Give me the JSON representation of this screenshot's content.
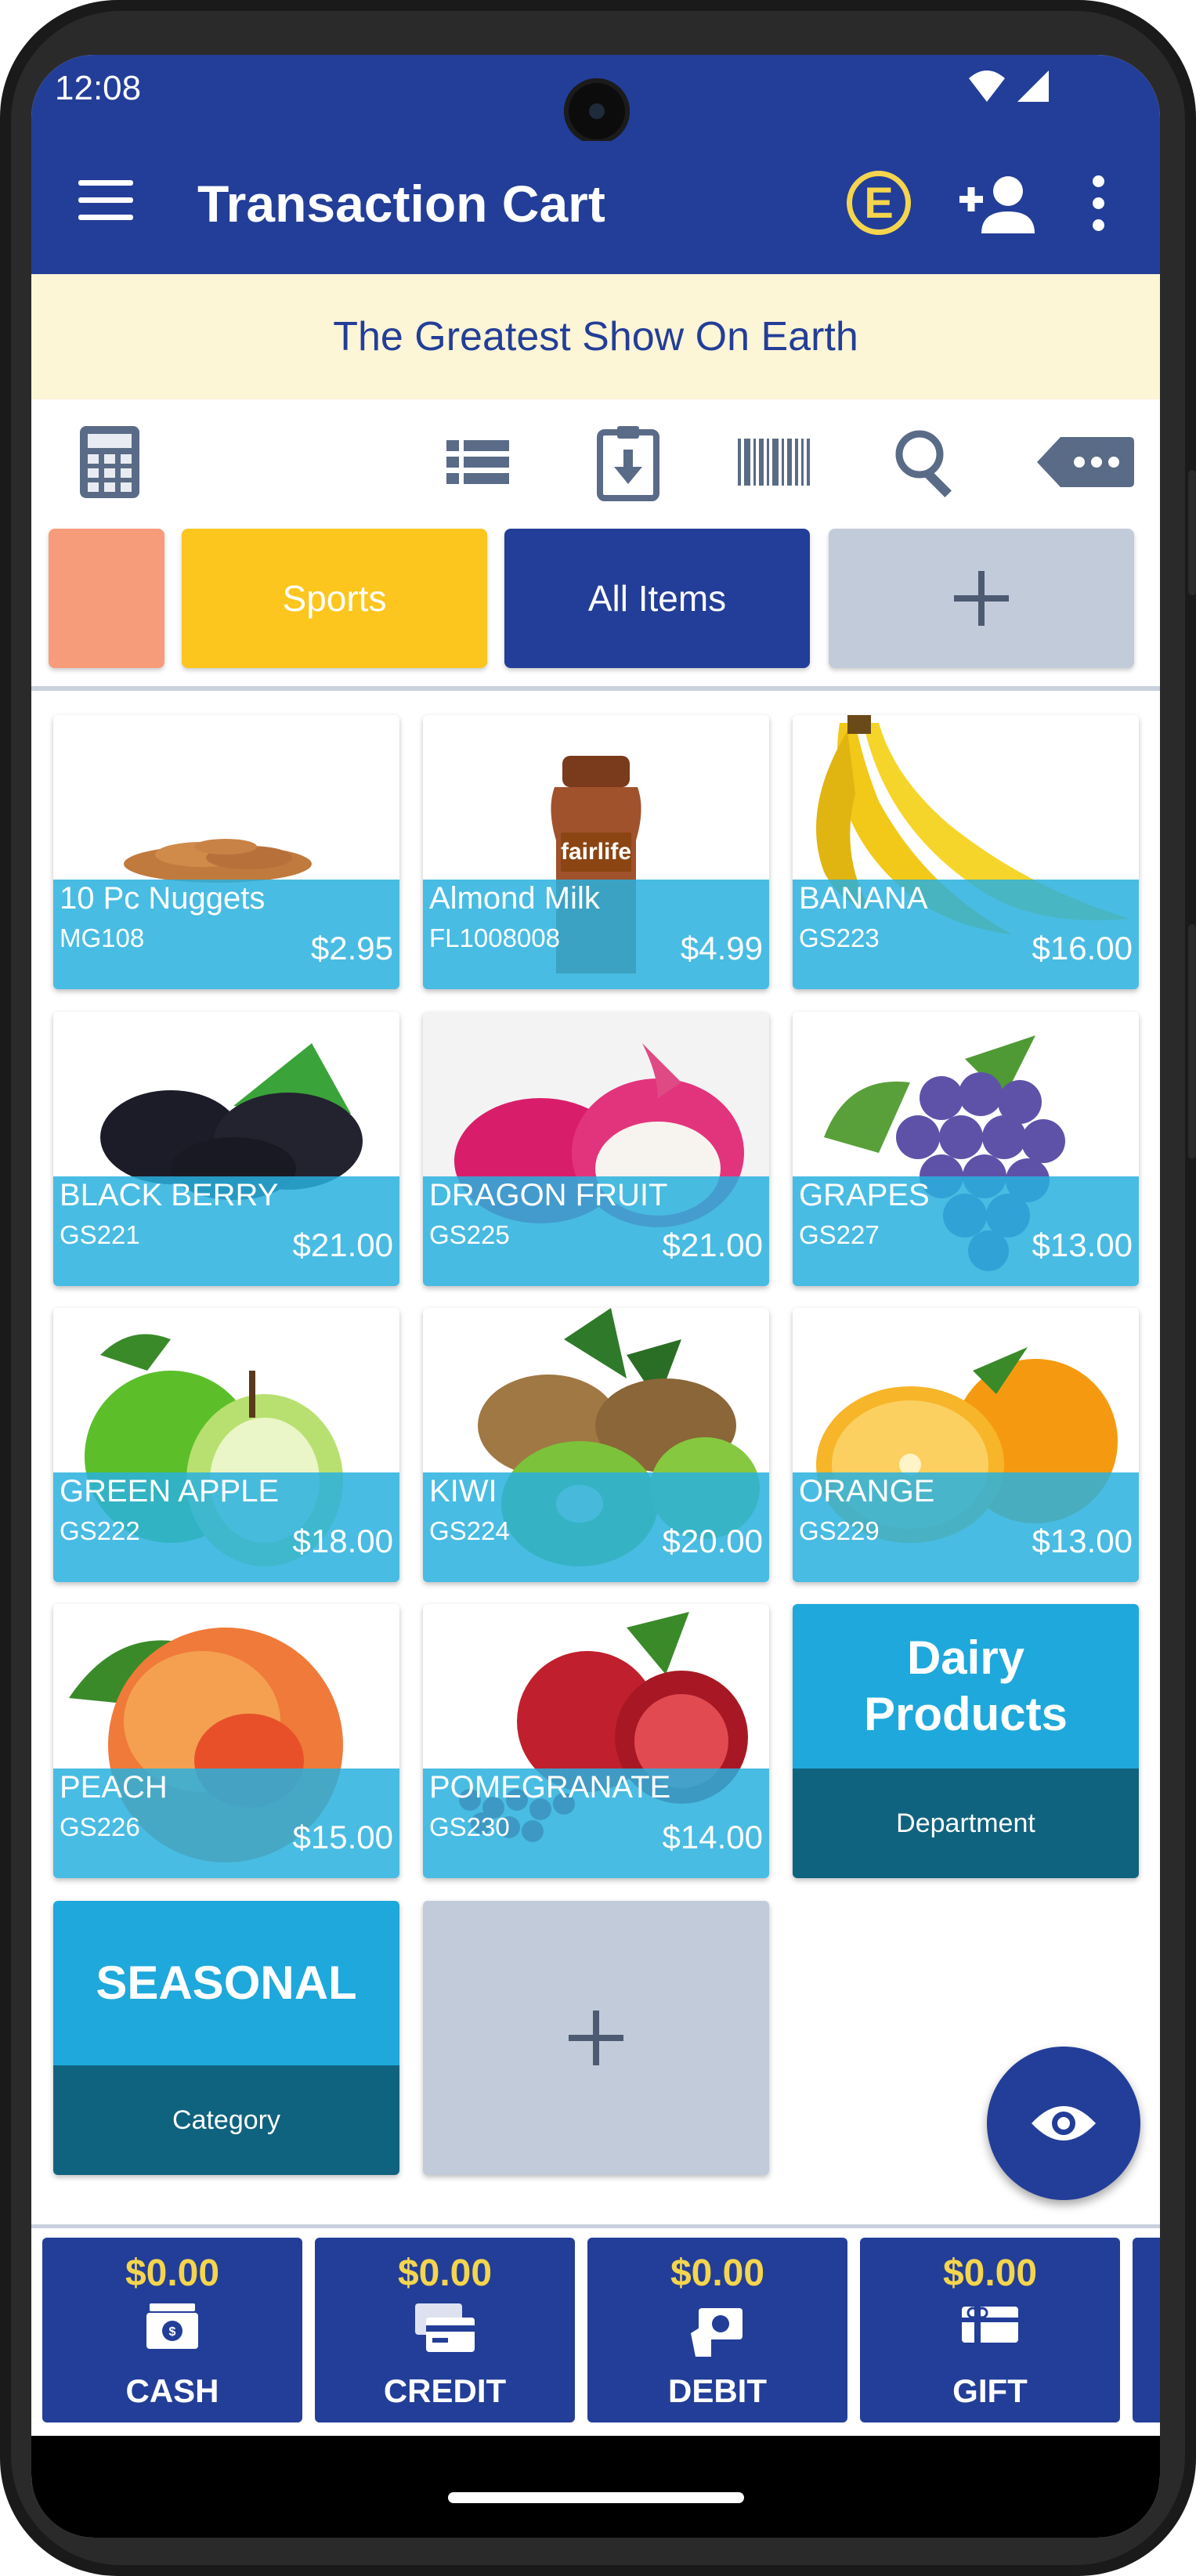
{
  "status_bar": {
    "time": "12:08",
    "icons": [
      "wifi-icon",
      "signal-icon"
    ]
  },
  "app_bar": {
    "title": "Transaction Cart",
    "badge_letter": "E"
  },
  "banner": {
    "text": "The Greatest Show On Earth"
  },
  "toolbar": [
    "calculator-icon",
    "list-view-icon",
    "import-clipboard-icon",
    "barcode-icon",
    "search-icon",
    "more-tag-icon"
  ],
  "categories": [
    {
      "label": "",
      "color": "#f79c7a"
    },
    {
      "label": "Sports",
      "color": "#fcc61f"
    },
    {
      "label": "All Items",
      "color": "#233e98"
    },
    {
      "label": "+",
      "color": "#c2cbda"
    }
  ],
  "items": [
    {
      "name": "10 Pc Nuggets",
      "code": "MG108",
      "price": "$2.95"
    },
    {
      "name": "Almond Milk",
      "code": "FL1008008",
      "price": "$4.99"
    },
    {
      "name": "BANANA",
      "code": "GS223",
      "price": "$16.00"
    },
    {
      "name": "BLACK BERRY",
      "code": "GS221",
      "price": "$21.00"
    },
    {
      "name": "DRAGON FRUIT",
      "code": "GS225",
      "price": "$21.00"
    },
    {
      "name": "GRAPES",
      "code": "GS227",
      "price": "$13.00"
    },
    {
      "name": "GREEN APPLE",
      "code": "GS222",
      "price": "$18.00"
    },
    {
      "name": "KIWI",
      "code": "GS224",
      "price": "$20.00"
    },
    {
      "name": "ORANGE",
      "code": "GS229",
      "price": "$13.00"
    },
    {
      "name": "PEACH",
      "code": "GS226",
      "price": "$15.00"
    },
    {
      "name": "POMEGRANATE",
      "code": "GS230",
      "price": "$14.00"
    }
  ],
  "tiles": {
    "dairy": {
      "title": "Dairy Products",
      "subtitle": "Department"
    },
    "seasonal": {
      "title": "SEASONAL",
      "subtitle": "Category"
    }
  },
  "payments": [
    {
      "amount": "$0.00",
      "label": "CASH"
    },
    {
      "amount": "$0.00",
      "label": "CREDIT"
    },
    {
      "amount": "$0.00",
      "label": "DEBIT"
    },
    {
      "amount": "$0.00",
      "label": "GIFT"
    }
  ],
  "colors": {
    "primary": "#233e98",
    "accent_yellow": "#f4d54d",
    "item_overlay": "#29b0de",
    "tile_top": "#1ea8dc",
    "tile_bottom": "#10637f"
  }
}
